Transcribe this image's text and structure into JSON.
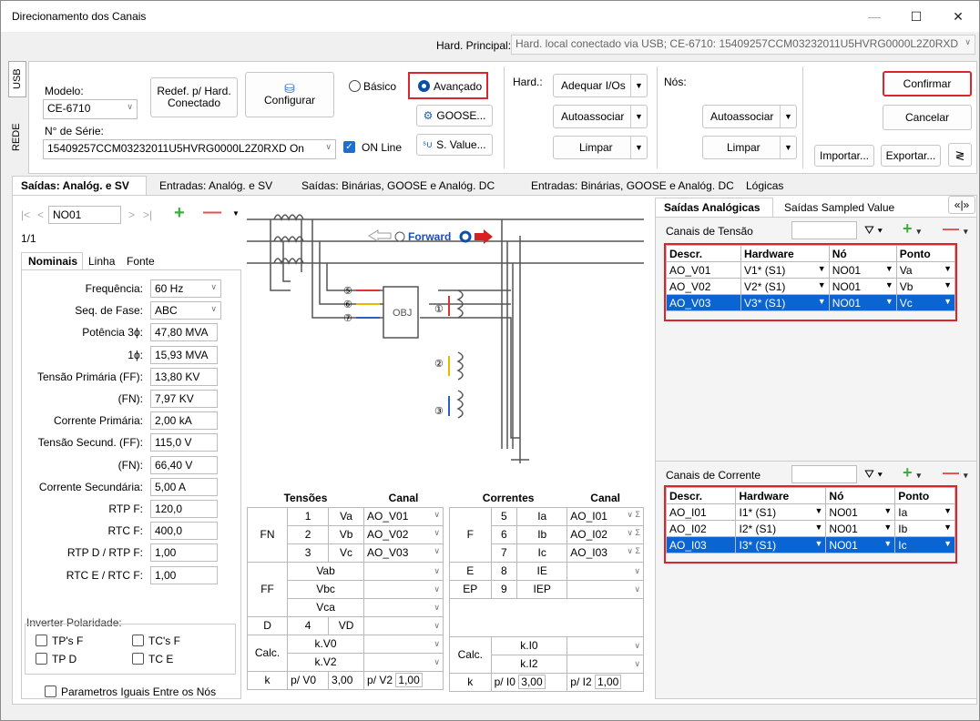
{
  "window": {
    "title": "Direcionamento dos Canais",
    "minimize": "—",
    "maximize": "☐",
    "close": "✕"
  },
  "hard_principal": {
    "label": "Hard. Principal:",
    "value": "Hard. local conectado via USB; CE-6710: 15409257CCM03232011U5HVRG0000L2Z0RXD"
  },
  "side_tabs": {
    "usb": "USB",
    "rede": "REDE"
  },
  "modelo": {
    "label": "Modelo:",
    "value": "CE-6710"
  },
  "serie": {
    "label": "N° de Série:",
    "value": "15409257CCM03232011U5HVRG0000L2Z0RXD On"
  },
  "buttons": {
    "redef": "Redef. p/ Hard. Conectado",
    "configurar": "Configurar",
    "goose": "GOOSE...",
    "svalue": "S. Value...",
    "adequar": "Adequar I/Os",
    "autoassociar": "Autoassociar",
    "limpar": "Limpar",
    "autoassociar2": "Autoassociar",
    "limpar2": "Limpar",
    "confirmar": "Confirmar",
    "cancelar": "Cancelar",
    "importar": "Importar...",
    "exportar": "Exportar..."
  },
  "mode": {
    "basico": "Básico",
    "avancado": "Avançado",
    "online": "ON Line"
  },
  "hard_label": "Hard.:",
  "nos_label": "Nós:",
  "main_tabs": [
    "Saídas: Analóg. e SV",
    "Entradas: Analóg. e SV",
    "Saídas: Binárias, GOOSE e Analóg. DC",
    "Entradas: Binárias, GOOSE e Analóg. DC",
    "Lógicas"
  ],
  "nav": {
    "node": "NO01",
    "page": "1/1"
  },
  "sub_tabs": [
    "Nominais",
    "Linha",
    "Fonte"
  ],
  "params": [
    {
      "label": "Frequência:",
      "value": "60 Hz"
    },
    {
      "label": "Seq. de Fase:",
      "value": "ABC"
    },
    {
      "label": "Potência 3ϕ:",
      "value": "47,80 MVA"
    },
    {
      "label": "1ϕ:",
      "value": "15,93 MVA"
    },
    {
      "label": "Tensão Primária (FF):",
      "value": "13,80 KV"
    },
    {
      "label": "(FN):",
      "value": "7,97 KV"
    },
    {
      "label": "Corrente Primária:",
      "value": "2,00 kA"
    },
    {
      "label": "Tensão Secund. (FF):",
      "value": "115,0 V"
    },
    {
      "label": "(FN):",
      "value": "66,40 V"
    },
    {
      "label": "Corrente Secundária:",
      "value": "5,00 A"
    },
    {
      "label": "RTP F:",
      "value": "120,0"
    },
    {
      "label": "RTC F:",
      "value": "400,0"
    },
    {
      "label": "RTP D / RTP F:",
      "value": "1,00"
    },
    {
      "label": "RTC E / RTC F:",
      "value": "1,00"
    }
  ],
  "inverter": {
    "label": "Inverter Polaridade:",
    "tpf": "TP's F",
    "tcf": "TC's F",
    "tpd": "TP D",
    "tce": "TC E"
  },
  "parametros_iguais": "Parametros Iguais Entre os Nós",
  "diagram": {
    "forward": "Forward",
    "obj": "OBJ",
    "m5": "⑤",
    "m6": "⑥",
    "m7": "⑦",
    "m1": "①",
    "m2": "②",
    "m3": "③"
  },
  "tensoes": {
    "h1": "Tensões",
    "h2": "Canal",
    "fn": "FN",
    "ff": "FF",
    "d": "D",
    "calc": "Calc.",
    "k": "k",
    "rows": [
      {
        "n": "1",
        "ph": "Va",
        "ch": "AO_V01"
      },
      {
        "n": "2",
        "ph": "Vb",
        "ch": "AO_V02"
      },
      {
        "n": "3",
        "ph": "Vc",
        "ch": "AO_V03"
      }
    ],
    "ffrows": [
      "Vab",
      "Vbc",
      "Vca"
    ],
    "vd_n": "4",
    "vd": "VD",
    "k0": "k.V0",
    "k2": "k.V2",
    "pv0": "p/ V0",
    "pv0v": "3,00",
    "pv2": "p/ V2",
    "pv2v": "1,00"
  },
  "correntes": {
    "h1": "Correntes",
    "h2": "Canal",
    "f": "F",
    "e": "E",
    "ep": "EP",
    "calc": "Calc.",
    "k": "k",
    "rows": [
      {
        "n": "5",
        "ph": "Ia",
        "ch": "AO_I01"
      },
      {
        "n": "6",
        "ph": "Ib",
        "ch": "AO_I02"
      },
      {
        "n": "7",
        "ph": "Ic",
        "ch": "AO_I03"
      }
    ],
    "ie_n": "8",
    "ie": "IE",
    "iep_n": "9",
    "iep": "IEP",
    "k0": "k.I0",
    "k2": "k.I2",
    "pi0": "p/ I0",
    "pi0v": "3,00",
    "pi2": "p/ I2",
    "pi2v": "1,00"
  },
  "right_tabs": [
    "Saídas Analógicas",
    "Saídas Sampled Value"
  ],
  "tensao_panel": {
    "title": "Canais de Tensão",
    "cols": [
      "Descr.",
      "Hardware",
      "Nó",
      "Ponto"
    ],
    "rows": [
      [
        "AO_V01",
        "V1* (S1)",
        "NO01",
        "Va"
      ],
      [
        "AO_V02",
        "V2* (S1)",
        "NO01",
        "Vb"
      ],
      [
        "AO_V03",
        "V3* (S1)",
        "NO01",
        "Vc"
      ]
    ]
  },
  "corrente_panel": {
    "title": "Canais de Corrente",
    "cols": [
      "Descr.",
      "Hardware",
      "Nó",
      "Ponto"
    ],
    "rows": [
      [
        "AO_I01",
        "I1* (S1)",
        "NO01",
        "Ia"
      ],
      [
        "AO_I02",
        "I2* (S1)",
        "NO01",
        "Ib"
      ],
      [
        "AO_I03",
        "I3* (S1)",
        "NO01",
        "Ic"
      ]
    ]
  }
}
